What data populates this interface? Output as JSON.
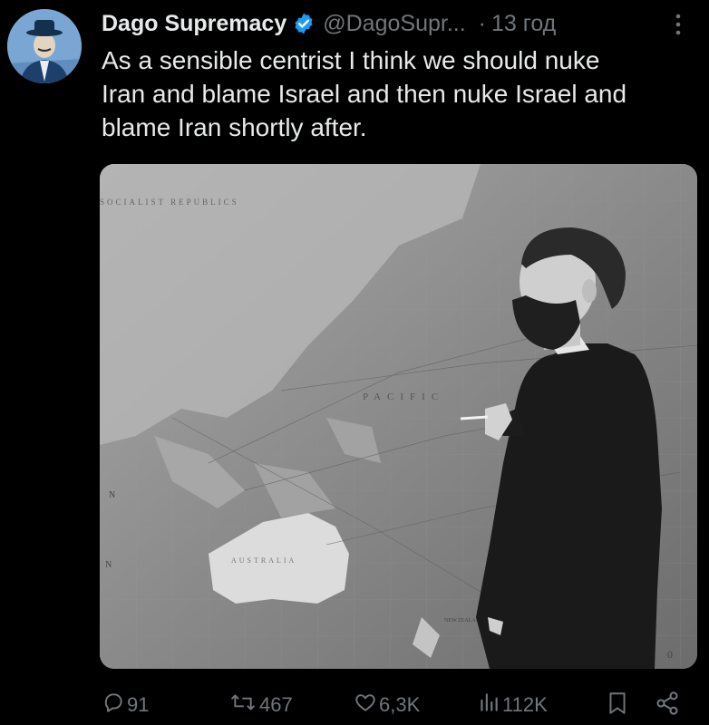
{
  "tweet": {
    "author_name": "Dago Supremacy",
    "handle": "@DagoSupr...",
    "separator": "·",
    "time": "13 год",
    "text": "As a sensible centrist I think we should nuke\nIran and blame Israel and then nuke Israel and\nblame Iran shortly after."
  },
  "media": {
    "map_labels": {
      "pacific": "PACIFIC",
      "socialist": "SOCIALIST REPUBLICS",
      "australia": "AUSTRALIA",
      "new_zealand": "NEW ZEALAND",
      "n_top": "N",
      "n_bottom": "N",
      "zero": "0"
    }
  },
  "actions": {
    "replies": "91",
    "reposts": "467",
    "likes": "6,3K",
    "views": "112K"
  },
  "colors": {
    "background": "#000000",
    "text": "#e7e9ea",
    "muted": "#71767b",
    "verified": "#1d9bf0"
  },
  "icons": [
    "reply-icon",
    "repost-icon",
    "like-icon",
    "views-icon",
    "bookmark-icon",
    "share-icon",
    "verified-badge-icon",
    "more-icon"
  ]
}
